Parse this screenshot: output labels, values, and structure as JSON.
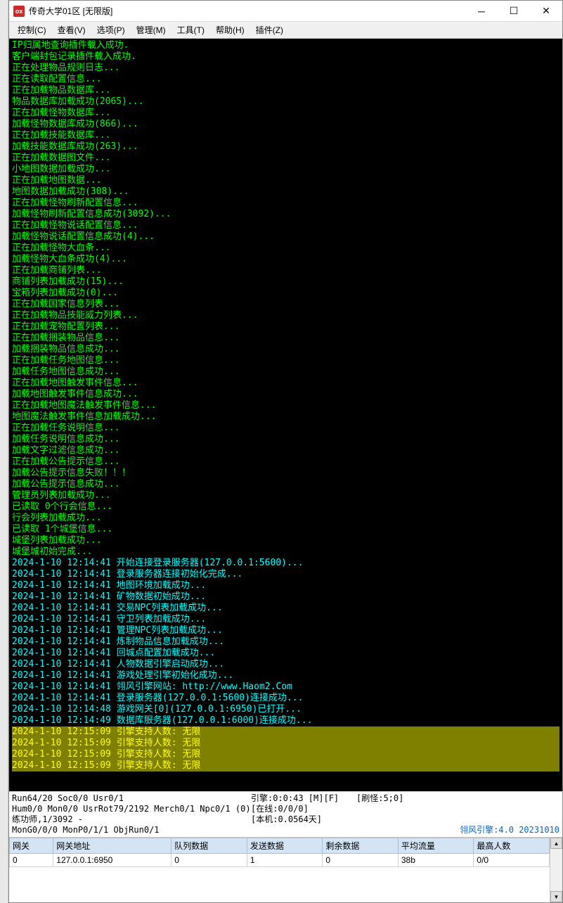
{
  "window": {
    "title": "传奇大学01区 [无限版]",
    "icon_text": "ox"
  },
  "menus": [
    {
      "label": "控制(C)"
    },
    {
      "label": "查看(V)"
    },
    {
      "label": "选项(P)"
    },
    {
      "label": "管理(M)"
    },
    {
      "label": "工具(T)"
    },
    {
      "label": "帮助(H)"
    },
    {
      "label": "插件(Z)"
    }
  ],
  "console_lines": [
    {
      "text": "IP归属地查询插件载入成功.",
      "cls": "c-green"
    },
    {
      "text": "客户端封包记录插件载入成功.",
      "cls": "c-green"
    },
    {
      "text": "正在处理物品规则日志...",
      "cls": "c-green"
    },
    {
      "text": "正在读取配置信息...",
      "cls": "c-green"
    },
    {
      "text": "正在加载物品数据库...",
      "cls": "c-green"
    },
    {
      "text": "物品数据库加载成功(2065)...",
      "cls": "c-green"
    },
    {
      "text": "正在加载怪物数据库...",
      "cls": "c-green"
    },
    {
      "text": "加载怪物数据库成功(866)...",
      "cls": "c-green"
    },
    {
      "text": "正在加载技能数据库...",
      "cls": "c-green"
    },
    {
      "text": "加载技能数据库成功(263)...",
      "cls": "c-green"
    },
    {
      "text": "正在加载数据图文件...",
      "cls": "c-green"
    },
    {
      "text": "小地图数据加载成功...",
      "cls": "c-green"
    },
    {
      "text": "正在加载地图数据...",
      "cls": "c-green"
    },
    {
      "text": "地图数据加载成功(308)...",
      "cls": "c-green"
    },
    {
      "text": "正在加载怪物刷新配置信息...",
      "cls": "c-green"
    },
    {
      "text": "加载怪物刷新配置信息成功(3092)...",
      "cls": "c-green"
    },
    {
      "text": "正在加载怪物说话配置信息...",
      "cls": "c-green"
    },
    {
      "text": "加载怪物说话配置信息成功(4)...",
      "cls": "c-green"
    },
    {
      "text": "正在加载怪物大血条...",
      "cls": "c-green"
    },
    {
      "text": "加载怪物大血条成功(4)...",
      "cls": "c-green"
    },
    {
      "text": "正在加载商铺列表...",
      "cls": "c-green"
    },
    {
      "text": "商铺列表加载成功(15)...",
      "cls": "c-green"
    },
    {
      "text": "宝箱列表加载成功(0)...",
      "cls": "c-green"
    },
    {
      "text": "正在加载国家信息列表...",
      "cls": "c-green"
    },
    {
      "text": "正在加载物品技能威力列表...",
      "cls": "c-green"
    },
    {
      "text": "正在加载宠物配置列表...",
      "cls": "c-green"
    },
    {
      "text": "正在加载捆装物品信息...",
      "cls": "c-green"
    },
    {
      "text": "加载捆装物品信息成功...",
      "cls": "c-green"
    },
    {
      "text": "正在加载任务地图信息...",
      "cls": "c-green"
    },
    {
      "text": "加载任务地图信息成功...",
      "cls": "c-green"
    },
    {
      "text": "正在加载地图触发事件信息...",
      "cls": "c-green"
    },
    {
      "text": "加载地图触发事件信息成功...",
      "cls": "c-green"
    },
    {
      "text": "正在加载地图魔法触发事件信息...",
      "cls": "c-green"
    },
    {
      "text": "地图魔法触发事件信息加载成功...",
      "cls": "c-green"
    },
    {
      "text": "正在加载任务说明信息...",
      "cls": "c-green"
    },
    {
      "text": "加载任务说明信息成功...",
      "cls": "c-green"
    },
    {
      "text": "加载文字过滤信息成功...",
      "cls": "c-green"
    },
    {
      "text": "正在加载公告提示信息...",
      "cls": "c-green"
    },
    {
      "text": "加载公告提示信息失败！！！",
      "cls": "c-green"
    },
    {
      "text": "加载公告提示信息成功...",
      "cls": "c-green"
    },
    {
      "text": "管理员列表加载成功...",
      "cls": "c-green"
    },
    {
      "text": "已读取 0个行会信息...",
      "cls": "c-green"
    },
    {
      "text": "行会列表加载成功...",
      "cls": "c-green"
    },
    {
      "text": "已读取 1个城堡信息...",
      "cls": "c-green"
    },
    {
      "text": "城堡列表加载成功...",
      "cls": "c-green"
    },
    {
      "text": "城堡城初始完成...",
      "cls": "c-green"
    },
    {
      "text": "2024-1-10 12:14:41 开始连接登录服务器(127.0.0.1:5600)...",
      "cls": "c-cyan"
    },
    {
      "text": "2024-1-10 12:14:41 登录服务器连接初始化完成...",
      "cls": "c-cyan"
    },
    {
      "text": "2024-1-10 12:14:41 地图环境加载成功...",
      "cls": "c-cyan"
    },
    {
      "text": "2024-1-10 12:14:41 矿物数据初始成功...",
      "cls": "c-cyan"
    },
    {
      "text": "2024-1-10 12:14:41 交易NPC列表加载成功...",
      "cls": "c-cyan"
    },
    {
      "text": "2024-1-10 12:14:41 守卫列表加载成功...",
      "cls": "c-cyan"
    },
    {
      "text": "2024-1-10 12:14:41 管理NPC列表加载成功...",
      "cls": "c-cyan"
    },
    {
      "text": "2024-1-10 12:14:41 炼制物品信息加载成功...",
      "cls": "c-cyan"
    },
    {
      "text": "2024-1-10 12:14:41 回城点配置加载成功...",
      "cls": "c-cyan"
    },
    {
      "text": "2024-1-10 12:14:41 人物数据引擎启动成功...",
      "cls": "c-cyan"
    },
    {
      "text": "2024-1-10 12:14:41 游戏处理引擎初始化成功...",
      "cls": "c-cyan"
    },
    {
      "text": "2024-1-10 12:14:41 翎风引擎网站: http://www.Haom2.Com",
      "cls": "c-cyan"
    },
    {
      "text": "2024-1-10 12:14:41 登录服务器(127.0.0.1:5600)连接成功...",
      "cls": "c-cyan"
    },
    {
      "text": "2024-1-10 12:14:48 游戏网关[0](127.0.0.1:6950)已打开...",
      "cls": "c-cyan"
    },
    {
      "text": "2024-1-10 12:14:49 数据库服务器(127.0.0.1:6000)连接成功...",
      "cls": "c-cyan"
    },
    {
      "text": "2024-1-10 12:15:09 引擎支持人数: 无限",
      "cls": "c-yellow"
    },
    {
      "text": "2024-1-10 12:15:09 引擎支持人数: 无限",
      "cls": "c-yellow"
    },
    {
      "text": "2024-1-10 12:15:09 引擎支持人数: 无限",
      "cls": "c-yellow"
    },
    {
      "text": "2024-1-10 12:15:09 引擎支持人数: 无限",
      "cls": "c-yellow"
    }
  ],
  "status": {
    "row1_left": "Run64/20 Soc0/0 Usr0/1",
    "row1_mid": "引擎:0:0:43 [M][F]",
    "row1_right": "[刷怪:5;0]",
    "row2_left": "Hum0/0 Mon0/0 UsrRot79/2192 Merch0/1 Npc0/1 (0)",
    "row2_right": "[在线:0/0/0]",
    "row3_left": "练功师,1/3092 -",
    "row3_right": "[本机:0.0564天]",
    "row4_left": "MonG0/0/0 MonP0/1/1 ObjRun0/1",
    "engine_version": "翎风引擎:4.0 20231010"
  },
  "table": {
    "headers": [
      "网关",
      "网关地址",
      "队列数据",
      "发送数据",
      "剩余数据",
      "平均流量",
      "最高人数"
    ],
    "rows": [
      [
        "0",
        "127.0.0.1:6950",
        "0",
        "1",
        "0",
        "38b",
        "0/0"
      ]
    ]
  }
}
